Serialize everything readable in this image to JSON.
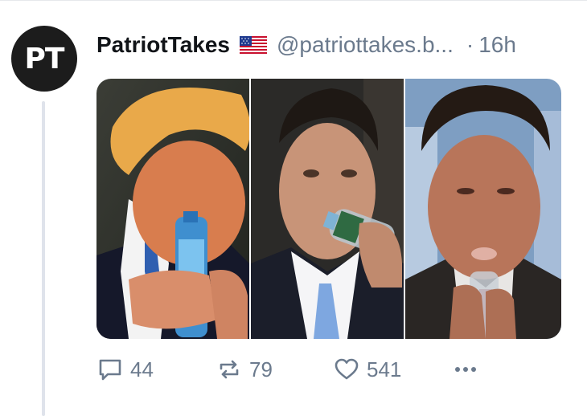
{
  "avatar": {
    "initials": "PT"
  },
  "post": {
    "author": "PatriotTakes",
    "handle": "@patriottakes.b...",
    "separator": "·",
    "time": "16h"
  },
  "media": {
    "panels": [
      {
        "subject": "man with orange hair drinking from a blue bottle"
      },
      {
        "subject": "man in dark suit drinking from a clear bottle"
      },
      {
        "subject": "man with slicked hair drinking from a bottle"
      }
    ]
  },
  "actions": {
    "replies": {
      "icon": "reply-icon",
      "count": "44"
    },
    "reposts": {
      "icon": "repost-icon",
      "count": "79"
    },
    "likes": {
      "icon": "heart-icon",
      "count": "541"
    },
    "more": {
      "icon": "more-icon"
    }
  },
  "colors": {
    "text": "#111418",
    "muted": "#6b7a8d",
    "thread": "#dfe3eb",
    "avatar_bg": "#1c1c1c"
  }
}
